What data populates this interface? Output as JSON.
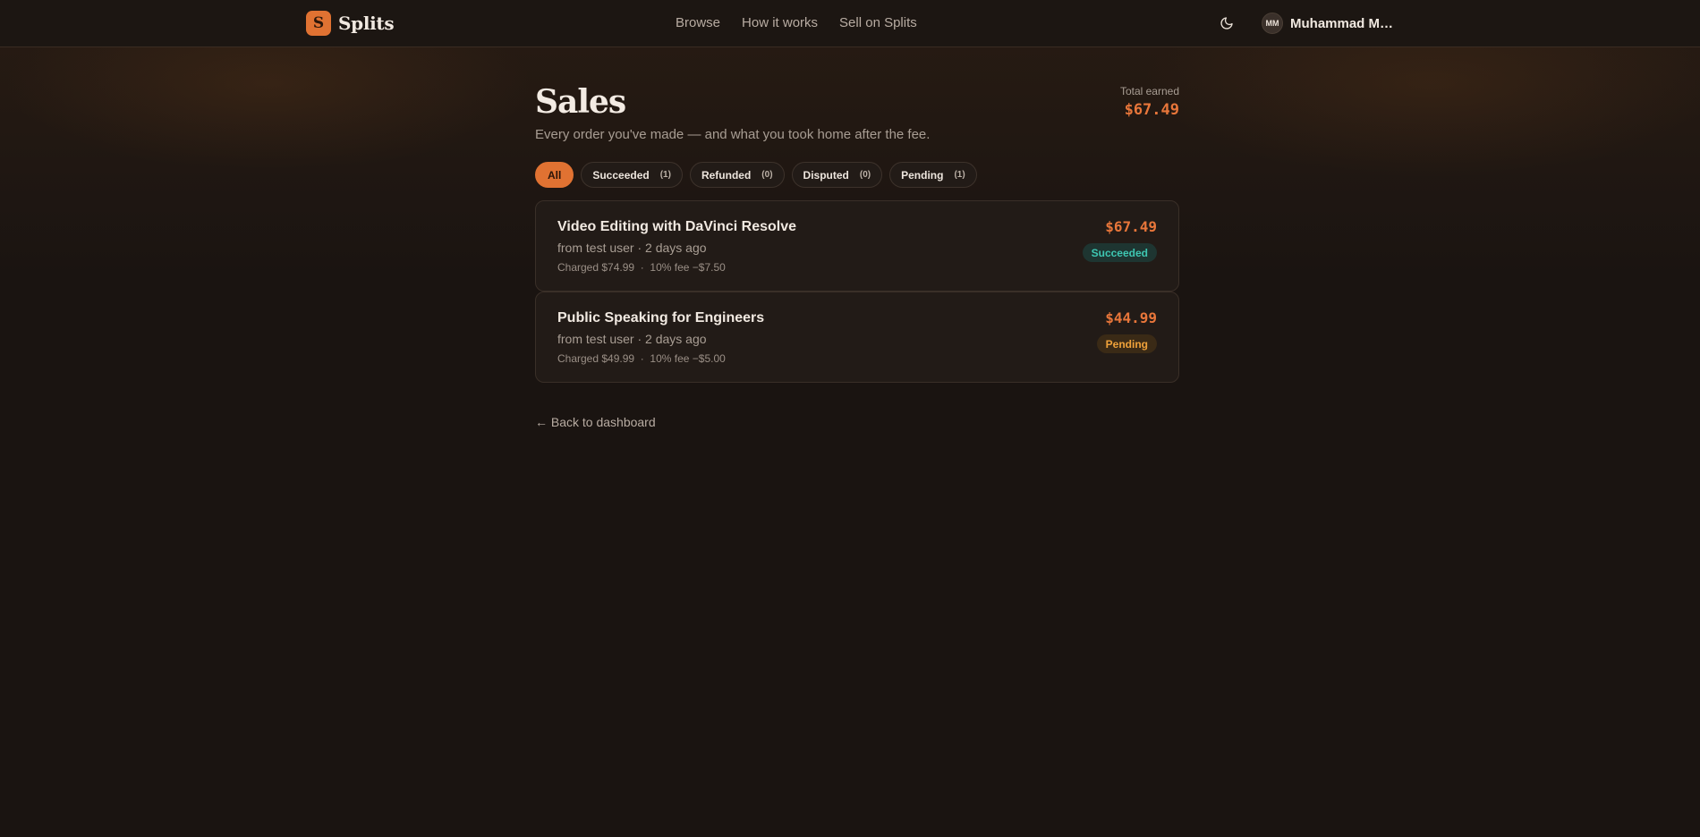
{
  "brand": {
    "logo_letter": "S",
    "name": "Splits"
  },
  "nav": {
    "items": [
      "Browse",
      "How it works",
      "Sell on Splits"
    ]
  },
  "user": {
    "initials": "MM",
    "name": "Muhammad Mu..."
  },
  "page": {
    "title": "Sales",
    "subtitle": "Every order you've made — and what you took home after the fee.",
    "total_label": "Total earned",
    "total_value": "$67.49"
  },
  "filters": [
    {
      "label": "All",
      "count": "",
      "active": true
    },
    {
      "label": "Succeeded",
      "count": "(1)",
      "active": false
    },
    {
      "label": "Refunded",
      "count": "(0)",
      "active": false
    },
    {
      "label": "Disputed",
      "count": "(0)",
      "active": false
    },
    {
      "label": "Pending",
      "count": "(1)",
      "active": false
    }
  ],
  "orders": [
    {
      "title": "Video Editing with DaVinci Resolve",
      "meta": "from test user · 2 days ago",
      "fee_line": "Charged $74.99  ·  10% fee −$7.50",
      "amount": "$67.49",
      "status": "Succeeded"
    },
    {
      "title": "Public Speaking for Engineers",
      "meta": "from test user · 2 days ago",
      "fee_line": "Charged $49.99  ·  10% fee −$5.00",
      "amount": "$44.99",
      "status": "Pending"
    }
  ],
  "back_link": "← Back to dashboard",
  "colors": {
    "accent": "#e07232",
    "background": "#1a1411",
    "success": "#3ec7b2",
    "pending": "#f0a23a"
  },
  "icons": {
    "theme_toggle": "moon-icon"
  }
}
